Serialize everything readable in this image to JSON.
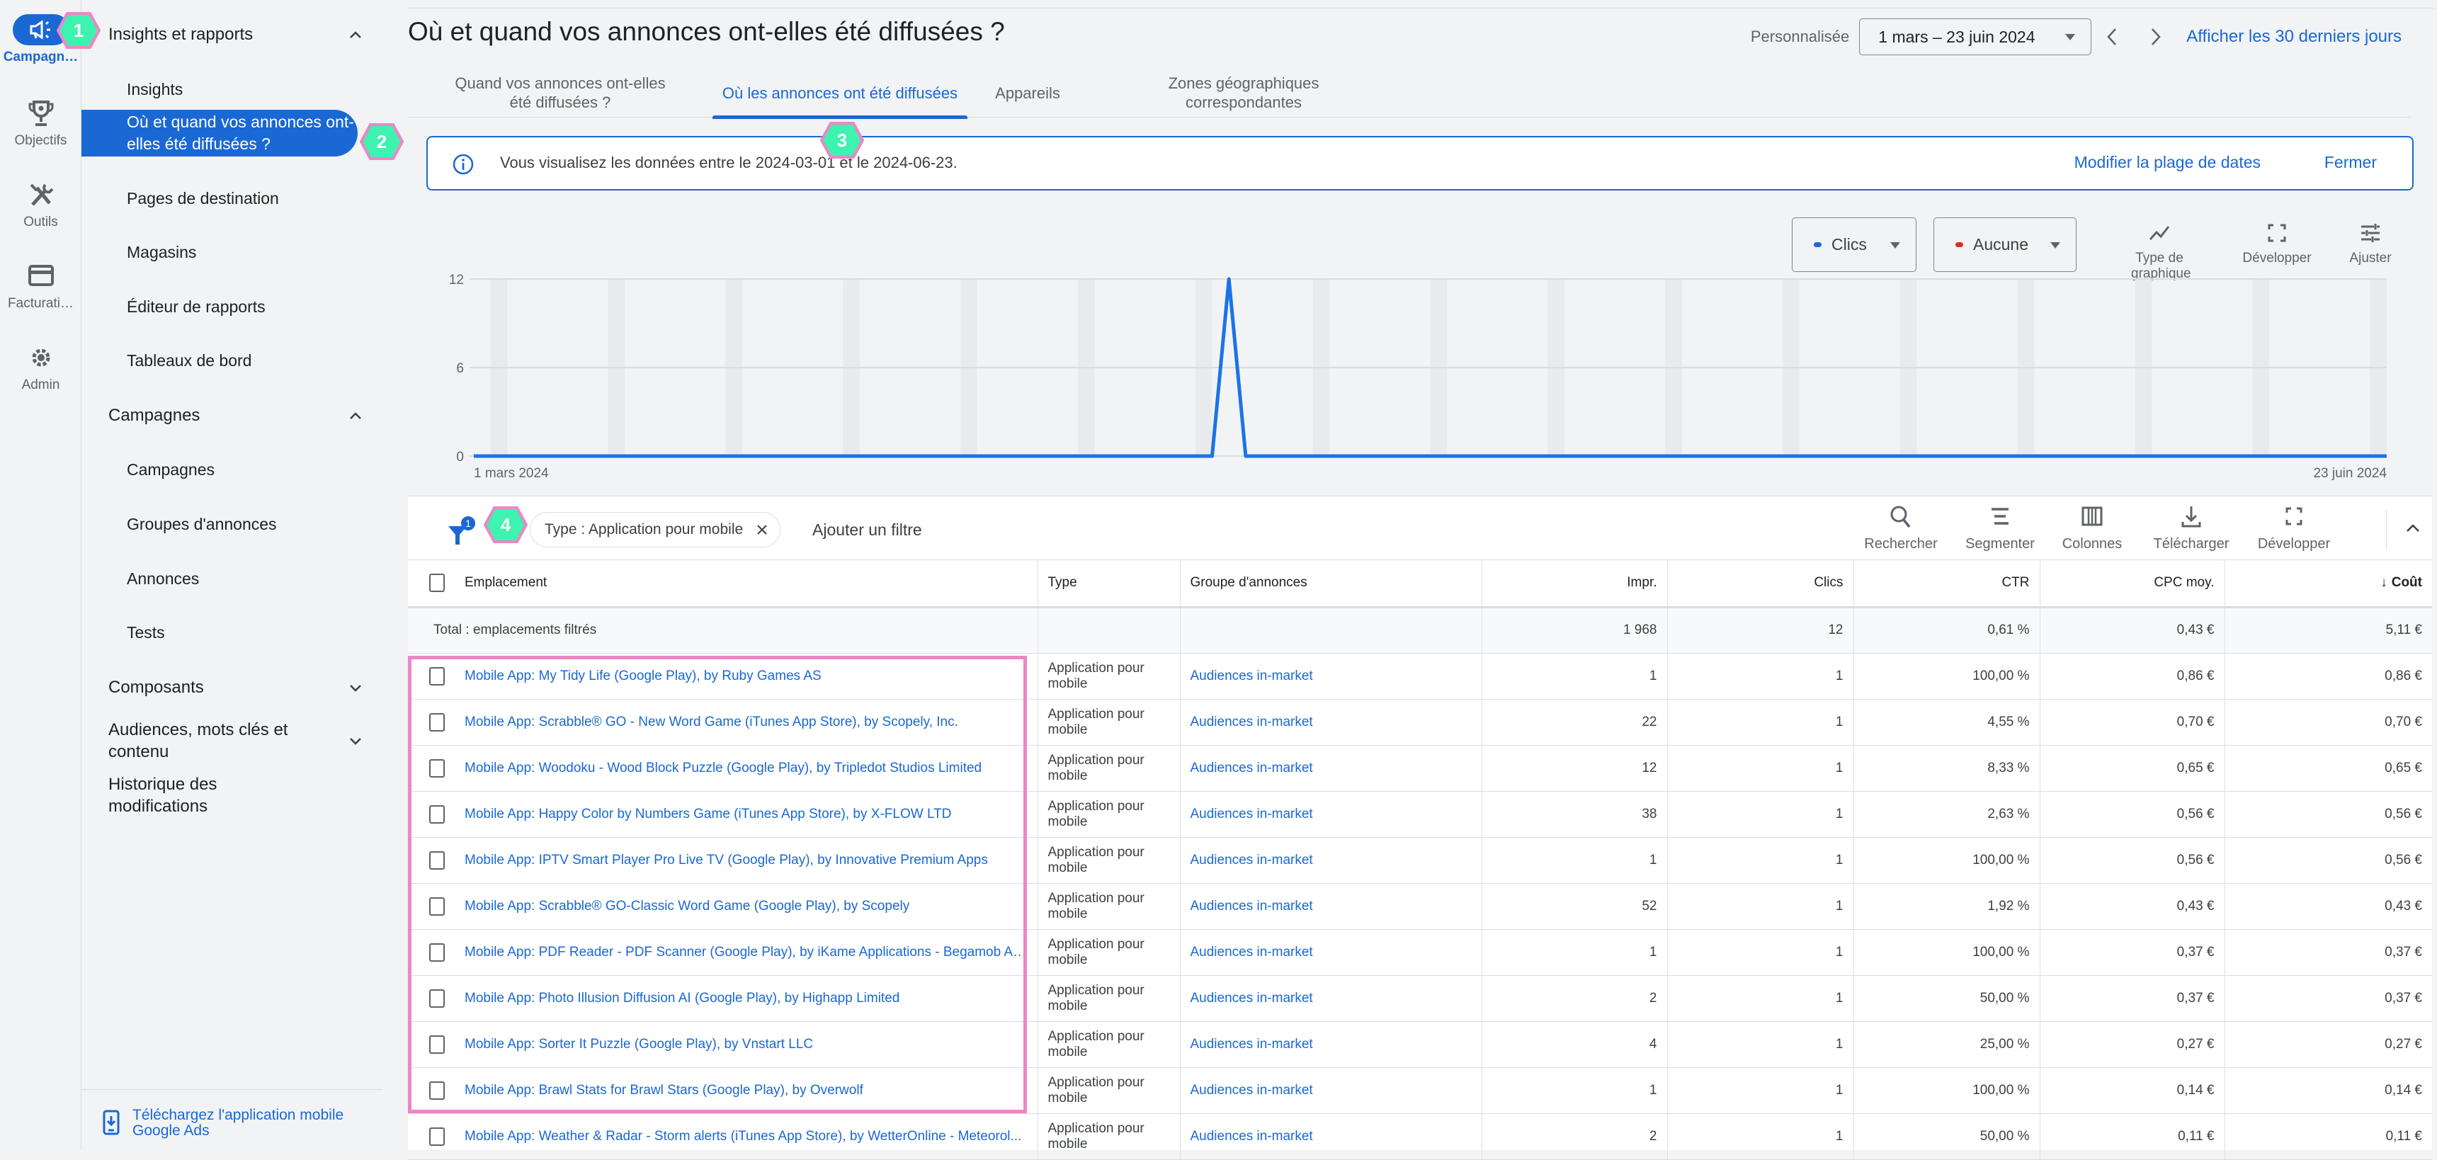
{
  "rail": {
    "items": [
      {
        "label": "Campagn…",
        "icon": "megaphone-icon",
        "active": true
      },
      {
        "label": "Objectifs",
        "icon": "trophy-icon"
      },
      {
        "label": "Outils",
        "icon": "tools-icon"
      },
      {
        "label": "Facturati…",
        "icon": "credit-card-icon"
      },
      {
        "label": "Admin",
        "icon": "gear-icon"
      }
    ]
  },
  "nav": {
    "sections": [
      {
        "label": "Insights et rapports",
        "expanded": true
      },
      {
        "label": "Campagnes",
        "expanded": true
      },
      {
        "label": "Composants",
        "expanded": false
      },
      {
        "label": "Audiences, mots clés et contenu",
        "expanded": false
      },
      {
        "label": "Historique des modifications"
      }
    ],
    "insights_items": [
      "Insights",
      "Où et quand vos annonces ont-elles été diffusées ?",
      "Pages de destination",
      "Magasins",
      "Éditeur de rapports",
      "Tableaux de bord"
    ],
    "campaign_items": [
      "Campagnes",
      "Groupes d'annonces",
      "Annonces",
      "Tests"
    ],
    "footer_link": "Téléchargez l'application mobile Google Ads"
  },
  "header": {
    "title": "Où et quand vos annonces ont-elles été diffusées ?",
    "date_preset": "Personnalisée",
    "date_range": "1 mars – 23 juin 2024",
    "last30_link": "Afficher les 30 derniers jours"
  },
  "tabs": [
    {
      "label": "Quand vos annonces ont-elles été diffusées ?",
      "active": false
    },
    {
      "label": "Où les annonces ont été diffusées",
      "active": true
    },
    {
      "label": "Appareils",
      "active": false
    },
    {
      "label": "Zones géographiques correspondantes",
      "active": false
    }
  ],
  "banner": {
    "message": "Vous visualisez les données entre le 2024-03-01 et le 2024-06-23.",
    "modify_link": "Modifier la plage de dates",
    "close_link": "Fermer"
  },
  "chart_controls": {
    "metric1": {
      "label": "Clics",
      "color": "#1a68d4"
    },
    "metric2": {
      "label": "Aucune",
      "color": "#d93025"
    },
    "tools": [
      "Type de graphique",
      "Développer",
      "Ajuster"
    ]
  },
  "chart_data": {
    "type": "line",
    "title": "",
    "xlabel": "",
    "ylabel": "",
    "x_start": "2024-03-01",
    "x_end": "2024-06-23",
    "x_tick_labels": [
      "1 mars 2024",
      "23 juin 2024"
    ],
    "y_ticks": [
      0,
      6,
      12
    ],
    "ylim": [
      0,
      12
    ],
    "grid": true,
    "weekend_bands": true,
    "series": [
      {
        "name": "Clics",
        "color": "#1a73e8",
        "points": [
          {
            "date": "2024-03-01",
            "value": 0
          },
          {
            "date": "2024-04-14",
            "value": 0
          },
          {
            "date": "2024-04-15",
            "value": 12
          },
          {
            "date": "2024-04-16",
            "value": 0
          },
          {
            "date": "2024-06-23",
            "value": 0
          }
        ]
      }
    ]
  },
  "table_toolbar": {
    "filter_count": "1",
    "filter_chip": "Type : Application pour mobile",
    "add_filter": "Ajouter un filtre",
    "tools": [
      "Rechercher",
      "Segmenter",
      "Colonnes",
      "Télécharger",
      "Développer"
    ]
  },
  "table": {
    "columns": [
      "Emplacement",
      "Type",
      "Groupe d'annonces",
      "Impr.",
      "Clics",
      "CTR",
      "CPC moy.",
      "Coût"
    ],
    "sort_column": "Coût",
    "total": {
      "label": "Total : emplacements filtrés",
      "impr": "1 968",
      "clics": "12",
      "ctr": "0,61 %",
      "cpc": "0,43 €",
      "cout": "5,11 €"
    },
    "rows": [
      {
        "place": "Mobile App: My Tidy Life (Google Play), by Ruby Games AS",
        "type": "Application pour mobile",
        "group": "Audiences in-market",
        "impr": "1",
        "clics": "1",
        "ctr": "100,00 %",
        "cpc": "0,86 €",
        "cout": "0,86 €"
      },
      {
        "place": "Mobile App: Scrabble® GO - New Word Game (iTunes App Store), by Scopely, Inc.",
        "type": "Application pour mobile",
        "group": "Audiences in-market",
        "impr": "22",
        "clics": "1",
        "ctr": "4,55 %",
        "cpc": "0,70 €",
        "cout": "0,70 €"
      },
      {
        "place": "Mobile App: Woodoku - Wood Block Puzzle (Google Play), by Tripledot Studios Limited",
        "type": "Application pour mobile",
        "group": "Audiences in-market",
        "impr": "12",
        "clics": "1",
        "ctr": "8,33 %",
        "cpc": "0,65 €",
        "cout": "0,65 €"
      },
      {
        "place": "Mobile App: Happy Color by Numbers Game (iTunes App Store), by X-FLOW LTD",
        "type": "Application pour mobile",
        "group": "Audiences in-market",
        "impr": "38",
        "clics": "1",
        "ctr": "2,63 %",
        "cpc": "0,56 €",
        "cout": "0,56 €"
      },
      {
        "place": "Mobile App: IPTV Smart Player Pro Live TV (Google Play), by Innovative Premium Apps",
        "type": "Application pour mobile",
        "group": "Audiences in-market",
        "impr": "1",
        "clics": "1",
        "ctr": "100,00 %",
        "cpc": "0,56 €",
        "cout": "0,56 €"
      },
      {
        "place": "Mobile App: Scrabble® GO-Classic Word Game (Google Play), by Scopely",
        "type": "Application pour mobile",
        "group": "Audiences in-market",
        "impr": "52",
        "clics": "1",
        "ctr": "1,92 %",
        "cpc": "0,43 €",
        "cout": "0,43 €"
      },
      {
        "place": "Mobile App: PDF Reader - PDF Scanner (Google Play), by iKame Applications - Begamob Ap...",
        "type": "Application pour mobile",
        "group": "Audiences in-market",
        "impr": "1",
        "clics": "1",
        "ctr": "100,00 %",
        "cpc": "0,37 €",
        "cout": "0,37 €"
      },
      {
        "place": "Mobile App: Photo Illusion Diffusion AI (Google Play), by Highapp Limited",
        "type": "Application pour mobile",
        "group": "Audiences in-market",
        "impr": "2",
        "clics": "1",
        "ctr": "50,00 %",
        "cpc": "0,37 €",
        "cout": "0,37 €"
      },
      {
        "place": "Mobile App: Sorter It Puzzle (Google Play), by Vnstart LLC",
        "type": "Application pour mobile",
        "group": "Audiences in-market",
        "impr": "4",
        "clics": "1",
        "ctr": "25,00 %",
        "cpc": "0,27 €",
        "cout": "0,27 €"
      },
      {
        "place": "Mobile App: Brawl Stats for Brawl Stars (Google Play), by Overwolf",
        "type": "Application pour mobile",
        "group": "Audiences in-market",
        "impr": "1",
        "clics": "1",
        "ctr": "100,00 %",
        "cpc": "0,14 €",
        "cout": "0,14 €"
      },
      {
        "place": "Mobile App: Weather & Radar - Storm alerts (iTunes App Store), by WetterOnline - Meteorol...",
        "type": "Application pour mobile",
        "group": "Audiences in-market",
        "impr": "2",
        "clics": "1",
        "ctr": "50,00 %",
        "cpc": "0,11 €",
        "cout": "0,11 €"
      }
    ]
  },
  "annotations": [
    "1",
    "2",
    "3",
    "4"
  ],
  "colors": {
    "accent": "#1a68d4",
    "annotation_fill": "#3ef2b0",
    "annotation_border": "#ef85c6"
  }
}
